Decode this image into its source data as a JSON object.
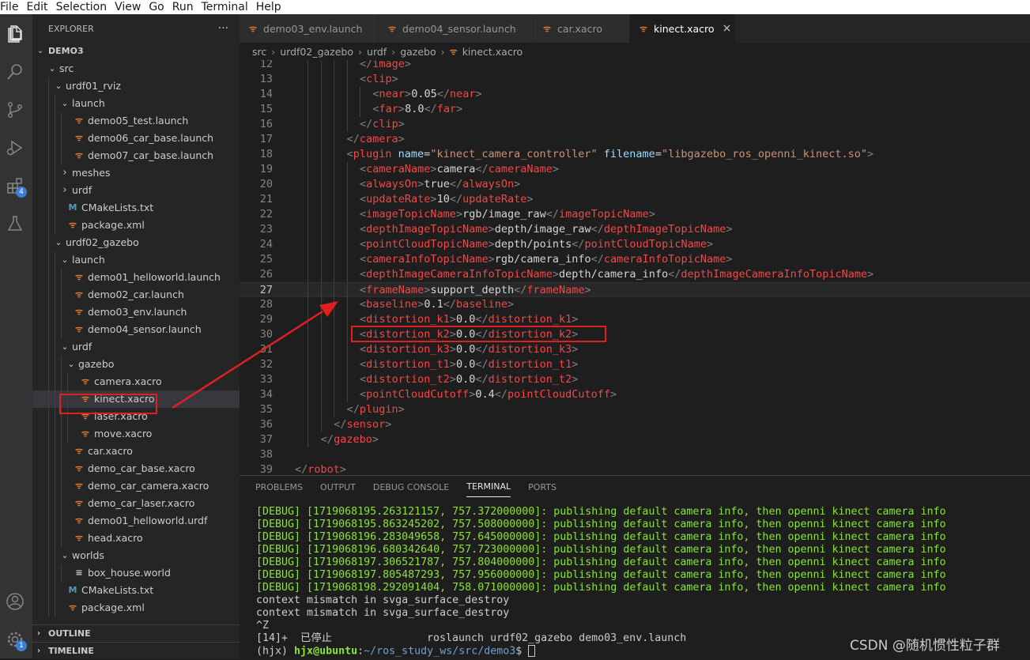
{
  "menu": [
    "File",
    "Edit",
    "Selection",
    "View",
    "Go",
    "Run",
    "Terminal",
    "Help"
  ],
  "activity_bar": {
    "extensions_badge": "4",
    "settings_badge": "1"
  },
  "explorer": {
    "title": "EXPLORER",
    "more": "···",
    "root": "DEMO3",
    "items": [
      {
        "label": "src",
        "depth": 0,
        "kind": "folder-open"
      },
      {
        "label": "urdf01_rviz",
        "depth": 1,
        "kind": "folder-open"
      },
      {
        "label": "launch",
        "depth": 2,
        "kind": "folder-open"
      },
      {
        "label": "demo05_test.launch",
        "depth": 3,
        "kind": "rss"
      },
      {
        "label": "demo06_car_base.launch",
        "depth": 3,
        "kind": "rss"
      },
      {
        "label": "demo07_car_base.launch",
        "depth": 3,
        "kind": "rss"
      },
      {
        "label": "meshes",
        "depth": 2,
        "kind": "folder-closed"
      },
      {
        "label": "urdf",
        "depth": 2,
        "kind": "folder-closed"
      },
      {
        "label": "CMakeLists.txt",
        "depth": 2,
        "kind": "cmake"
      },
      {
        "label": "package.xml",
        "depth": 2,
        "kind": "rss"
      },
      {
        "label": "urdf02_gazebo",
        "depth": 1,
        "kind": "folder-open"
      },
      {
        "label": "launch",
        "depth": 2,
        "kind": "folder-open"
      },
      {
        "label": "demo01_helloworld.launch",
        "depth": 3,
        "kind": "rss"
      },
      {
        "label": "demo02_car.launch",
        "depth": 3,
        "kind": "rss"
      },
      {
        "label": "demo03_env.launch",
        "depth": 3,
        "kind": "rss"
      },
      {
        "label": "demo04_sensor.launch",
        "depth": 3,
        "kind": "rss"
      },
      {
        "label": "urdf",
        "depth": 2,
        "kind": "folder-open"
      },
      {
        "label": "gazebo",
        "depth": 3,
        "kind": "folder-open"
      },
      {
        "label": "camera.xacro",
        "depth": 4,
        "kind": "rss"
      },
      {
        "label": "kinect.xacro",
        "depth": 4,
        "kind": "rss",
        "selected": true
      },
      {
        "label": "laser.xacro",
        "depth": 4,
        "kind": "rss"
      },
      {
        "label": "move.xacro",
        "depth": 4,
        "kind": "rss"
      },
      {
        "label": "car.xacro",
        "depth": 3,
        "kind": "rss"
      },
      {
        "label": "demo_car_base.xacro",
        "depth": 3,
        "kind": "rss"
      },
      {
        "label": "demo_car_camera.xacro",
        "depth": 3,
        "kind": "rss"
      },
      {
        "label": "demo_car_laser.xacro",
        "depth": 3,
        "kind": "rss"
      },
      {
        "label": "demo01_helloworld.urdf",
        "depth": 3,
        "kind": "rss"
      },
      {
        "label": "head.xacro",
        "depth": 3,
        "kind": "rss"
      },
      {
        "label": "worlds",
        "depth": 2,
        "kind": "folder-open"
      },
      {
        "label": "box_house.world",
        "depth": 3,
        "kind": "lines"
      },
      {
        "label": "CMakeLists.txt",
        "depth": 2,
        "kind": "cmake"
      },
      {
        "label": "package.xml",
        "depth": 2,
        "kind": "rss"
      }
    ],
    "outline": "OUTLINE",
    "timeline": "TIMELINE"
  },
  "tabs": [
    {
      "label": "demo03_env.launch",
      "active": false
    },
    {
      "label": "demo04_sensor.launch",
      "active": false
    },
    {
      "label": "car.xacro",
      "active": false
    },
    {
      "label": "kinect.xacro",
      "active": true
    }
  ],
  "breadcrumb": [
    "src",
    "urdf02_gazebo",
    "urdf",
    "gazebo",
    "kinect.xacro"
  ],
  "code": {
    "current_line": "27",
    "lines": [
      {
        "n": "12",
        "indent": 5,
        "segs": [
          [
            "p",
            "</"
          ],
          [
            "t",
            "image"
          ],
          [
            "p",
            ">"
          ]
        ]
      },
      {
        "n": "13",
        "indent": 5,
        "segs": [
          [
            "p",
            "<"
          ],
          [
            "t",
            "clip"
          ],
          [
            "p",
            ">"
          ]
        ]
      },
      {
        "n": "14",
        "indent": 6,
        "segs": [
          [
            "p",
            "<"
          ],
          [
            "t",
            "near"
          ],
          [
            "p",
            ">"
          ],
          [
            "x",
            "0.05"
          ],
          [
            "p",
            "</"
          ],
          [
            "t",
            "near"
          ],
          [
            "p",
            ">"
          ]
        ]
      },
      {
        "n": "15",
        "indent": 6,
        "segs": [
          [
            "p",
            "<"
          ],
          [
            "t",
            "far"
          ],
          [
            "p",
            ">"
          ],
          [
            "x",
            "8.0"
          ],
          [
            "p",
            "</"
          ],
          [
            "t",
            "far"
          ],
          [
            "p",
            ">"
          ]
        ]
      },
      {
        "n": "16",
        "indent": 5,
        "segs": [
          [
            "p",
            "</"
          ],
          [
            "t",
            "clip"
          ],
          [
            "p",
            ">"
          ]
        ]
      },
      {
        "n": "17",
        "indent": 4,
        "segs": [
          [
            "p",
            "</"
          ],
          [
            "t",
            "camera"
          ],
          [
            "p",
            ">"
          ]
        ]
      },
      {
        "n": "18",
        "indent": 4,
        "segs": [
          [
            "p",
            "<"
          ],
          [
            "t",
            "plugin"
          ],
          [
            "x",
            " "
          ],
          [
            "a",
            "name"
          ],
          [
            "x",
            "="
          ],
          [
            "s",
            "\"kinect_camera_controller\""
          ],
          [
            "x",
            " "
          ],
          [
            "a",
            "filename"
          ],
          [
            "x",
            "="
          ],
          [
            "s",
            "\"libgazebo_ros_openni_kinect.so\""
          ],
          [
            "p",
            ">"
          ]
        ]
      },
      {
        "n": "19",
        "indent": 5,
        "segs": [
          [
            "p",
            "<"
          ],
          [
            "t",
            "cameraName"
          ],
          [
            "p",
            ">"
          ],
          [
            "x",
            "camera"
          ],
          [
            "p",
            "</"
          ],
          [
            "t",
            "cameraName"
          ],
          [
            "p",
            ">"
          ]
        ]
      },
      {
        "n": "20",
        "indent": 5,
        "segs": [
          [
            "p",
            "<"
          ],
          [
            "t",
            "alwaysOn"
          ],
          [
            "p",
            ">"
          ],
          [
            "x",
            "true"
          ],
          [
            "p",
            "</"
          ],
          [
            "t",
            "alwaysOn"
          ],
          [
            "p",
            ">"
          ]
        ]
      },
      {
        "n": "21",
        "indent": 5,
        "segs": [
          [
            "p",
            "<"
          ],
          [
            "t",
            "updateRate"
          ],
          [
            "p",
            ">"
          ],
          [
            "x",
            "10"
          ],
          [
            "p",
            "</"
          ],
          [
            "t",
            "updateRate"
          ],
          [
            "p",
            ">"
          ]
        ]
      },
      {
        "n": "22",
        "indent": 5,
        "segs": [
          [
            "p",
            "<"
          ],
          [
            "t",
            "imageTopicName"
          ],
          [
            "p",
            ">"
          ],
          [
            "x",
            "rgb/image_raw"
          ],
          [
            "p",
            "</"
          ],
          [
            "t",
            "imageTopicName"
          ],
          [
            "p",
            ">"
          ]
        ]
      },
      {
        "n": "23",
        "indent": 5,
        "segs": [
          [
            "p",
            "<"
          ],
          [
            "t",
            "depthImageTopicName"
          ],
          [
            "p",
            ">"
          ],
          [
            "x",
            "depth/image_raw"
          ],
          [
            "p",
            "</"
          ],
          [
            "t",
            "depthImageTopicName"
          ],
          [
            "p",
            ">"
          ]
        ]
      },
      {
        "n": "24",
        "indent": 5,
        "segs": [
          [
            "p",
            "<"
          ],
          [
            "t",
            "pointCloudTopicName"
          ],
          [
            "p",
            ">"
          ],
          [
            "x",
            "depth/points"
          ],
          [
            "p",
            "</"
          ],
          [
            "t",
            "pointCloudTopicName"
          ],
          [
            "p",
            ">"
          ]
        ]
      },
      {
        "n": "25",
        "indent": 5,
        "segs": [
          [
            "p",
            "<"
          ],
          [
            "t",
            "cameraInfoTopicName"
          ],
          [
            "p",
            ">"
          ],
          [
            "x",
            "rgb/camera_info"
          ],
          [
            "p",
            "</"
          ],
          [
            "t",
            "cameraInfoTopicName"
          ],
          [
            "p",
            ">"
          ]
        ]
      },
      {
        "n": "26",
        "indent": 5,
        "segs": [
          [
            "p",
            "<"
          ],
          [
            "t",
            "depthImageCameraInfoTopicName"
          ],
          [
            "p",
            ">"
          ],
          [
            "x",
            "depth/camera_info"
          ],
          [
            "p",
            "</"
          ],
          [
            "t",
            "depthImageCameraInfoTopicName"
          ],
          [
            "p",
            ">"
          ]
        ]
      },
      {
        "n": "27",
        "indent": 5,
        "segs": [
          [
            "p",
            "<"
          ],
          [
            "t",
            "frameName"
          ],
          [
            "p",
            ">"
          ],
          [
            "x",
            "support_depth"
          ],
          [
            "p",
            "</"
          ],
          [
            "t",
            "frameName"
          ],
          [
            "p",
            ">"
          ]
        ]
      },
      {
        "n": "28",
        "indent": 5,
        "segs": [
          [
            "p",
            "<"
          ],
          [
            "t",
            "baseline"
          ],
          [
            "p",
            ">"
          ],
          [
            "x",
            "0.1"
          ],
          [
            "p",
            "</"
          ],
          [
            "t",
            "baseline"
          ],
          [
            "p",
            ">"
          ]
        ]
      },
      {
        "n": "29",
        "indent": 5,
        "segs": [
          [
            "p",
            "<"
          ],
          [
            "t",
            "distortion_k1"
          ],
          [
            "p",
            ">"
          ],
          [
            "x",
            "0.0"
          ],
          [
            "p",
            "</"
          ],
          [
            "t",
            "distortion_k1"
          ],
          [
            "p",
            ">"
          ]
        ]
      },
      {
        "n": "30",
        "indent": 5,
        "segs": [
          [
            "p",
            "<"
          ],
          [
            "t",
            "distortion_k2"
          ],
          [
            "p",
            ">"
          ],
          [
            "x",
            "0.0"
          ],
          [
            "p",
            "</"
          ],
          [
            "t",
            "distortion_k2"
          ],
          [
            "p",
            ">"
          ]
        ]
      },
      {
        "n": "31",
        "indent": 5,
        "segs": [
          [
            "p",
            "<"
          ],
          [
            "t",
            "distortion_k3"
          ],
          [
            "p",
            ">"
          ],
          [
            "x",
            "0.0"
          ],
          [
            "p",
            "</"
          ],
          [
            "t",
            "distortion_k3"
          ],
          [
            "p",
            ">"
          ]
        ]
      },
      {
        "n": "32",
        "indent": 5,
        "segs": [
          [
            "p",
            "<"
          ],
          [
            "t",
            "distortion_t1"
          ],
          [
            "p",
            ">"
          ],
          [
            "x",
            "0.0"
          ],
          [
            "p",
            "</"
          ],
          [
            "t",
            "distortion_t1"
          ],
          [
            "p",
            ">"
          ]
        ]
      },
      {
        "n": "33",
        "indent": 5,
        "segs": [
          [
            "p",
            "<"
          ],
          [
            "t",
            "distortion_t2"
          ],
          [
            "p",
            ">"
          ],
          [
            "x",
            "0.0"
          ],
          [
            "p",
            "</"
          ],
          [
            "t",
            "distortion_t2"
          ],
          [
            "p",
            ">"
          ]
        ]
      },
      {
        "n": "34",
        "indent": 5,
        "segs": [
          [
            "p",
            "<"
          ],
          [
            "t",
            "pointCloudCutoff"
          ],
          [
            "p",
            ">"
          ],
          [
            "x",
            "0.4"
          ],
          [
            "p",
            "</"
          ],
          [
            "t",
            "pointCloudCutoff"
          ],
          [
            "p",
            ">"
          ]
        ]
      },
      {
        "n": "35",
        "indent": 4,
        "segs": [
          [
            "p",
            "</"
          ],
          [
            "t",
            "plugin"
          ],
          [
            "p",
            ">"
          ]
        ]
      },
      {
        "n": "36",
        "indent": 3,
        "segs": [
          [
            "p",
            "</"
          ],
          [
            "t",
            "sensor"
          ],
          [
            "p",
            ">"
          ]
        ]
      },
      {
        "n": "37",
        "indent": 2,
        "segs": [
          [
            "p",
            "</"
          ],
          [
            "t",
            "gazebo"
          ],
          [
            "p",
            ">"
          ]
        ]
      },
      {
        "n": "38",
        "indent": 0,
        "segs": []
      },
      {
        "n": "39",
        "indent": 0,
        "segs": [
          [
            "p",
            "</"
          ],
          [
            "t",
            "robot"
          ],
          [
            "p",
            ">"
          ]
        ]
      }
    ]
  },
  "panel": {
    "tabs": [
      "PROBLEMS",
      "OUTPUT",
      "DEBUG CONSOLE",
      "TERMINAL",
      "PORTS"
    ],
    "active_tab": "TERMINAL",
    "debug_lines": [
      "[DEBUG] [1719068195.263121157, 757.372000000]: publishing default camera info, then openni kinect camera info",
      "[DEBUG] [1719068195.863245202, 757.508000000]: publishing default camera info, then openni kinect camera info",
      "[DEBUG] [1719068196.283049658, 757.645000000]: publishing default camera info, then openni kinect camera info",
      "[DEBUG] [1719068196.680342640, 757.723000000]: publishing default camera info, then openni kinect camera info",
      "[DEBUG] [1719068197.306521787, 757.804000000]: publishing default camera info, then openni kinect camera info",
      "[DEBUG] [1719068197.805487293, 757.956000000]: publishing default camera info, then openni kinect camera info",
      "[DEBUG] [1719068198.292091404, 758.071000000]: publishing default camera info, then openni kinect camera info"
    ],
    "plain_lines": [
      "context mismatch in svga_surface_destroy",
      "context mismatch in svga_surface_destroy",
      "^Z",
      "[14]+  已停止               roslaunch urdf02_gazebo demo03_env.launch"
    ],
    "prompt": {
      "env": "(hjx) ",
      "user": "hjx@ubuntu",
      "sep": ":",
      "path": "~/ros_study_ws/src/demo3",
      "end": "$ "
    }
  },
  "watermark": "CSDN @随机惯性粒子群"
}
